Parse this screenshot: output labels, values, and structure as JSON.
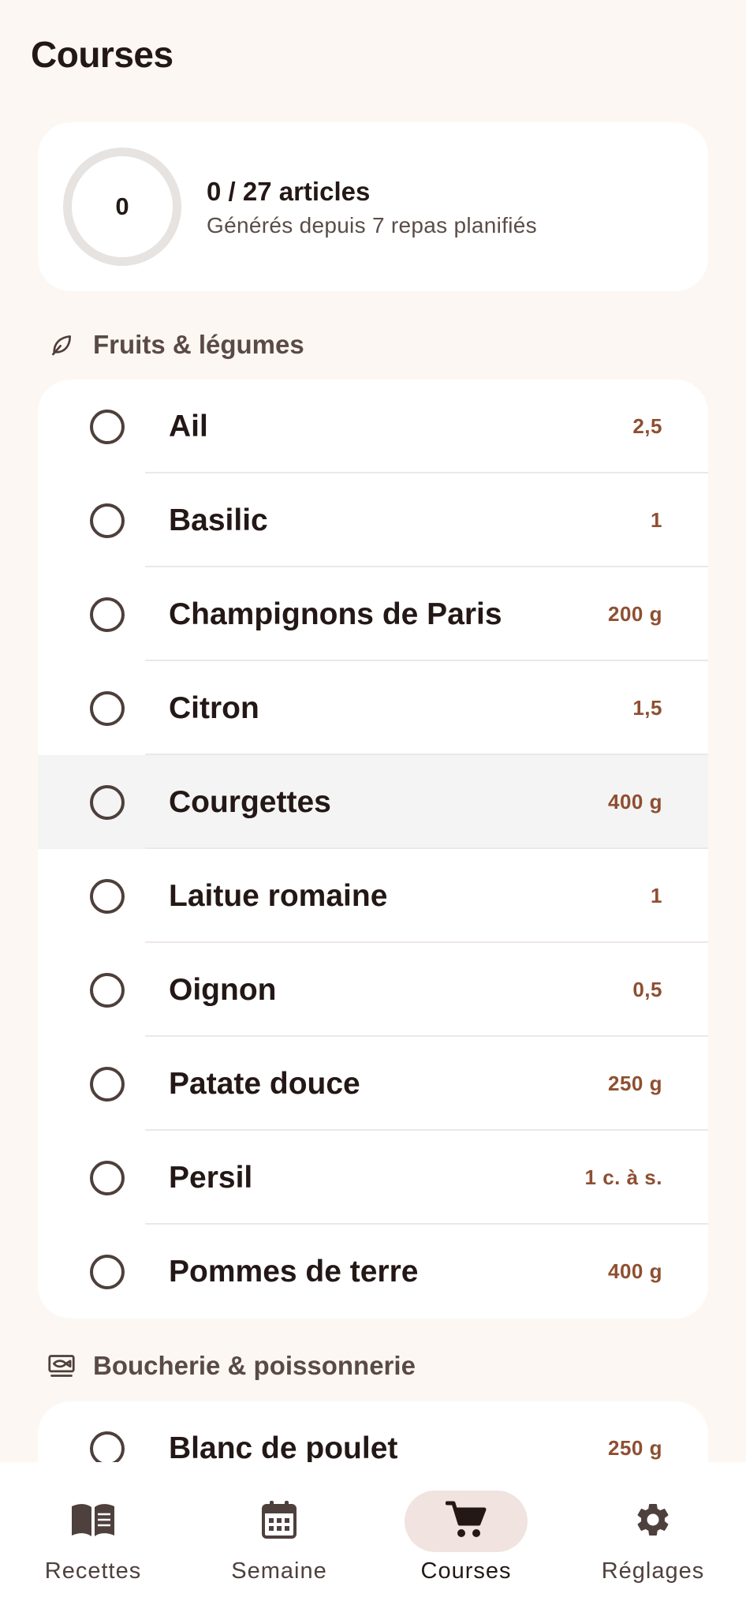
{
  "page": {
    "title": "Courses"
  },
  "summary": {
    "checked": "0",
    "count_label": "0 / 27 articles",
    "subtitle": "Générés depuis 7 repas planifiés",
    "progress": 0
  },
  "sections": [
    {
      "label": "Fruits & légumes",
      "icon": "leaf-icon",
      "items": [
        {
          "name": "Ail",
          "qty": "2,5"
        },
        {
          "name": "Basilic",
          "qty": "1"
        },
        {
          "name": "Champignons de Paris",
          "qty": "200 g"
        },
        {
          "name": "Citron",
          "qty": "1,5"
        },
        {
          "name": "Courgettes",
          "qty": "400 g"
        },
        {
          "name": "Laitue romaine",
          "qty": "1"
        },
        {
          "name": "Oignon",
          "qty": "0,5"
        },
        {
          "name": "Patate douce",
          "qty": "250 g"
        },
        {
          "name": "Persil",
          "qty": "1 c. à s."
        },
        {
          "name": "Pommes de terre",
          "qty": "400 g"
        }
      ]
    },
    {
      "label": "Boucherie & poissonnerie",
      "icon": "fish-tray-icon",
      "items": [
        {
          "name": "Blanc de poulet",
          "qty": "250 g"
        }
      ]
    }
  ],
  "nav": [
    {
      "label": "Recettes",
      "icon": "book-icon",
      "active": false
    },
    {
      "label": "Semaine",
      "icon": "calendar-icon",
      "active": false
    },
    {
      "label": "Courses",
      "icon": "cart-icon",
      "active": true
    },
    {
      "label": "Réglages",
      "icon": "gear-icon",
      "active": false
    }
  ],
  "colors": {
    "background": "#FCF7F2",
    "card": "#FFFFFF",
    "quantity": "#8E4F31",
    "active_pill": "#F1E3DF",
    "text": "#231815"
  }
}
